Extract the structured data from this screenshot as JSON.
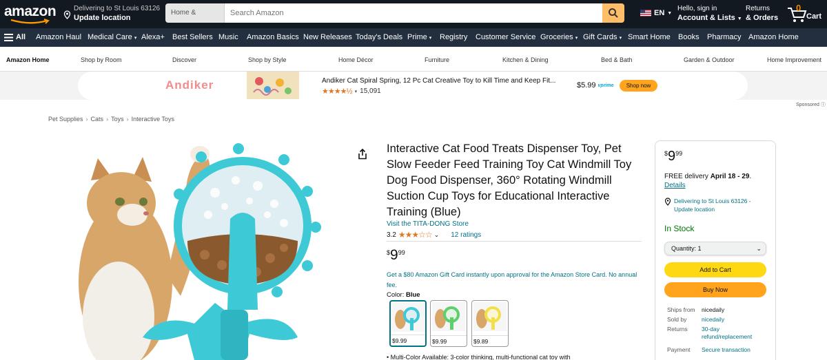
{
  "header": {
    "logo_text": "amazon",
    "deliver_line1": "Delivering to St Louis 63126",
    "deliver_line2": "Update location",
    "search_category": "Home & Kitchen",
    "search_placeholder": "Search Amazon",
    "language": "EN",
    "account_line1": "Hello, sign in",
    "account_line2": "Account & Lists",
    "returns_line1": "Returns",
    "returns_line2": "& Orders",
    "cart_count": "0",
    "cart_label": "Cart"
  },
  "subnav": {
    "all_label": "All",
    "items": [
      "Amazon Haul",
      "Medical Care",
      "Alexa+",
      "Best Sellers",
      "Music",
      "Amazon Basics",
      "New Releases",
      "Today's Deals",
      "Prime",
      "Registry",
      "Customer Service",
      "Groceries",
      "Gift Cards",
      "Smart Home",
      "Books",
      "Pharmacy",
      "Amazon Home"
    ]
  },
  "storenav": {
    "items": [
      "Amazon Home",
      "Shop by Room",
      "Discover",
      "Shop by Style",
      "Home Décor",
      "Furniture",
      "Kitchen & Dining",
      "Bed & Bath",
      "Garden & Outdoor",
      "Home Improvement"
    ]
  },
  "banner": {
    "brand": "Andiker",
    "title": "Andiker Cat Spiral Spring, 12 Pc Cat Creative Toy to Kill Time and Keep Fit...",
    "rating_count": "15,091",
    "price": "$5.99",
    "prime": "vprime",
    "cta": "Shop now",
    "sponsored": "Sponsored"
  },
  "breadcrumb": [
    "Pet Supplies",
    "Cats",
    "Toys",
    "Interactive Toys"
  ],
  "product": {
    "title": "Interactive Cat Food Treats Dispenser Toy, Pet Slow Feeder Feed Training Toy Cat Windmill Toy Dog Food Dispenser, 360° Rotating Windmill Suction Cup Toys for Educational Interactive Training (Blue)",
    "store": "Visit the TITA-DONG Store",
    "rating": "3.2",
    "rating_count": "12 ratings",
    "price_symbol": "$",
    "price_whole": "9",
    "price_fraction": "99",
    "promo": "Get a $80 Amazon Gift Card instantly upon approval for the Amazon Store Card. No annual fee.",
    "color_label": "Color:",
    "color_value": "Blue",
    "swatches": [
      {
        "price": "$9.99",
        "color": "#3ec9d6"
      },
      {
        "price": "$9.99",
        "color": "#5fcf6e"
      },
      {
        "price": "$9.89",
        "color": "#f2e04a"
      }
    ],
    "bullet": "Multi-Color Available: 3-color thinking, multi-functional cat toy with"
  },
  "buybox": {
    "price_symbol": "$",
    "price_whole": "9",
    "price_fraction": "99",
    "delivery_prefix": "FREE delivery",
    "delivery_dates": "April 18 - 29",
    "details": "Details",
    "location": "Delivering to St Louis 63126 - Update location",
    "stock": "In Stock",
    "quantity_label": "Quantity:",
    "quantity_value": "1",
    "add_to_cart": "Add to Cart",
    "buy_now": "Buy Now",
    "ships_from_label": "Ships from",
    "ships_from_value": "nicedaily",
    "sold_by_label": "Sold by",
    "sold_by_value": "nicedaily",
    "returns_label": "Returns",
    "returns_value": "30-day refund/replacement",
    "payment_label": "Payment",
    "payment_value": "Secure transaction"
  },
  "colors": {
    "nav_dark": "#131921",
    "nav_sub": "#232f3e",
    "search_button": "#febd69",
    "cart_button": "#ffd814",
    "buy_button": "#ffa41c",
    "link": "#007185",
    "in_stock": "#007600",
    "star": "#de7921"
  }
}
